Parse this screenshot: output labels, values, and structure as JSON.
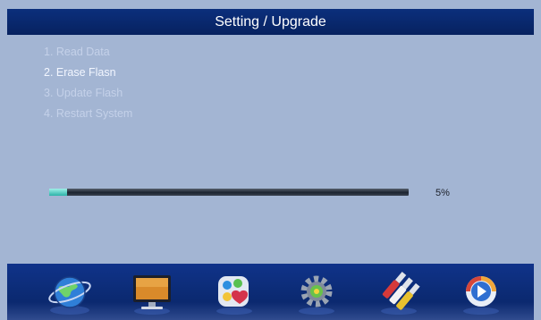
{
  "header": {
    "title": "Setting / Upgrade"
  },
  "steps": [
    {
      "label": "1. Read Data"
    },
    {
      "label": "2. Erase Flasn"
    },
    {
      "label": "3. Update Flash"
    },
    {
      "label": "4. Restart System"
    }
  ],
  "active_step": 1,
  "progress": {
    "value": 0.05,
    "label": "5%"
  },
  "dock": {
    "icons": [
      "globe-network-icon",
      "tv-monitor-icon",
      "media-balls-icon",
      "settings-gear-icon",
      "av-cables-icon",
      "play-button-icon"
    ]
  },
  "colors": {
    "title_bar": "#0b2f7c",
    "panel_bg": "#a3b5d3",
    "dock_bg": "#0b2a72",
    "progress_fill": "#2cb3a8"
  }
}
